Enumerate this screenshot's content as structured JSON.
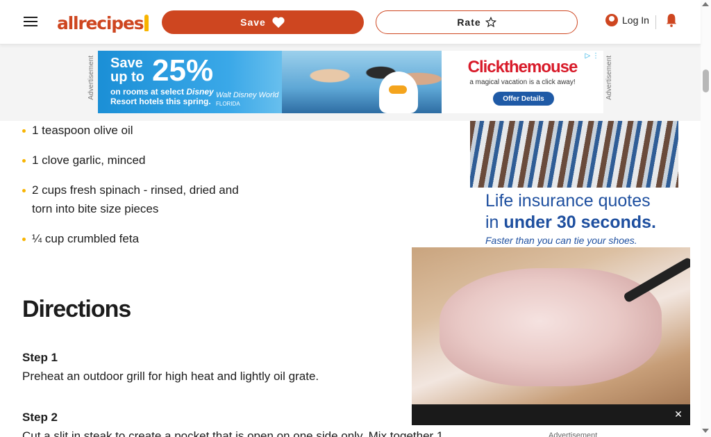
{
  "header": {
    "logo_text": "allrecipes",
    "save_label": "Save",
    "rate_label": "Rate",
    "login_label": "Log In",
    "icons": [
      "hamburger-menu-icon",
      "heart-icon",
      "star-outline-icon",
      "user-icon",
      "bell-icon"
    ]
  },
  "top_ad": {
    "side_label": "Advertisement",
    "headline": "Save up to",
    "percent": "25%",
    "subtext_1": "on rooms at select",
    "subtext_brand": "Disney",
    "subtext_2": "Resort hotels this spring.",
    "brand": "Walt Disney World",
    "brand_sub": "FLORIDA",
    "advertiser": "Clickthemouse",
    "advertiser_tagline": "a magical vacation is a click away!",
    "cta": "Offer Details"
  },
  "ingredients": [
    "1 teaspoon olive oil",
    "1 clove garlic, minced",
    "2 cups fresh spinach - rinsed, dried and torn into bite size pieces",
    "¼ cup crumbled feta"
  ],
  "directions": {
    "title": "Directions",
    "steps": [
      {
        "title": "Step 1",
        "text": "Preheat an outdoor grill for high heat and lightly oil grate."
      },
      {
        "title": "Step 2",
        "text": "Cut a slit in steak to create a pocket that is open on one side only. Mix together 1"
      }
    ]
  },
  "rail_ad": {
    "headline_1": "Life insurance quotes",
    "headline_2_prefix": "in",
    "headline_2_bold": "under 30 seconds.",
    "sub": "Faster than you can tie your shoes."
  },
  "video": {
    "close_label": "✕",
    "caption": "Advertisement"
  },
  "colors": {
    "brand": "#ce4620",
    "bullet": "#f8b400",
    "rail_ad_text": "#1e4f9f"
  }
}
